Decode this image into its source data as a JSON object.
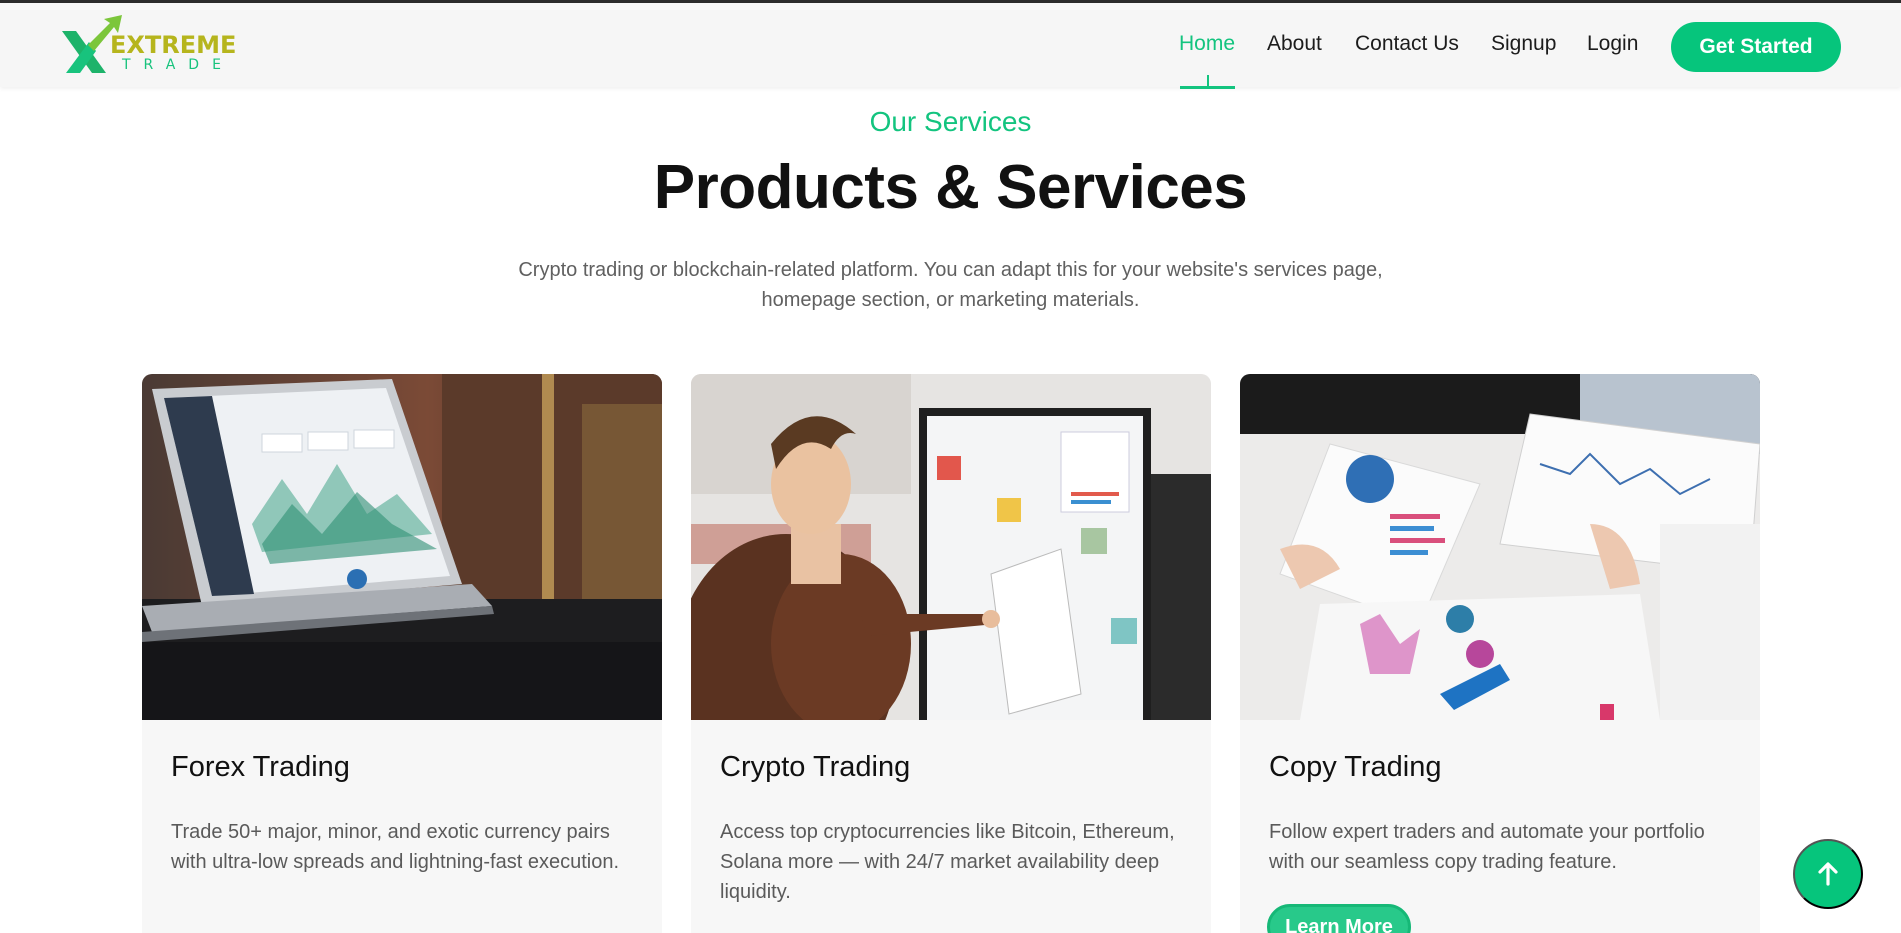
{
  "brand": {
    "word1": "EXTREME",
    "word2": "TRADE",
    "colors": {
      "accent": "#13c47f",
      "olive": "#b6b51d"
    }
  },
  "nav": {
    "items": [
      {
        "label": "Home",
        "active": true
      },
      {
        "label": "About"
      },
      {
        "label": "Contact Us"
      },
      {
        "label": "Signup"
      },
      {
        "label": "Login"
      }
    ],
    "cta": "Get Started"
  },
  "section": {
    "eyebrow": "Our Services",
    "title": "Products & Services",
    "description": "Crypto trading or blockchain-related platform. You can adapt this for your website's services page, homepage section, or marketing materials."
  },
  "cards": [
    {
      "title": "Forex Trading",
      "text": "Trade 50+ major, minor, and exotic currency pairs with ultra-low spreads and lightning-fast execution.",
      "image": "laptop-dashboard-photo"
    },
    {
      "title": "Crypto Trading",
      "text": "Access top cryptocurrencies like Bitcoin, Ethereum, Solana more — with 24/7 market availability deep liquidity.",
      "image": "presenter-whiteboard-photo"
    },
    {
      "title": "Copy Trading",
      "text": "Follow expert traders and automate your portfolio with our seamless copy trading feature.",
      "image": "charts-on-desk-photo",
      "button": "Learn More"
    }
  ],
  "scroll_top": {
    "icon": "arrow-up-icon"
  }
}
